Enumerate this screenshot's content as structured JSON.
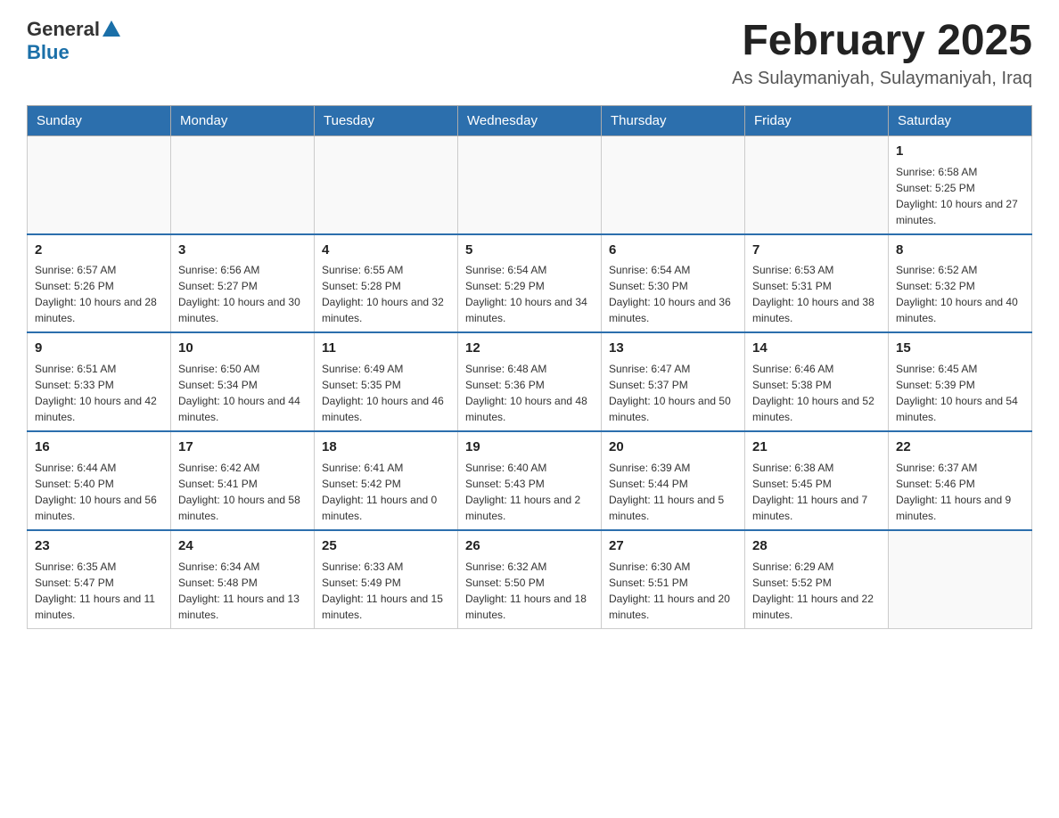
{
  "header": {
    "logo_general": "General",
    "logo_blue": "Blue",
    "month_title": "February 2025",
    "location": "As Sulaymaniyah, Sulaymaniyah, Iraq"
  },
  "weekdays": [
    "Sunday",
    "Monday",
    "Tuesday",
    "Wednesday",
    "Thursday",
    "Friday",
    "Saturday"
  ],
  "weeks": [
    [
      {
        "day": "",
        "info": ""
      },
      {
        "day": "",
        "info": ""
      },
      {
        "day": "",
        "info": ""
      },
      {
        "day": "",
        "info": ""
      },
      {
        "day": "",
        "info": ""
      },
      {
        "day": "",
        "info": ""
      },
      {
        "day": "1",
        "info": "Sunrise: 6:58 AM\nSunset: 5:25 PM\nDaylight: 10 hours and 27 minutes."
      }
    ],
    [
      {
        "day": "2",
        "info": "Sunrise: 6:57 AM\nSunset: 5:26 PM\nDaylight: 10 hours and 28 minutes."
      },
      {
        "day": "3",
        "info": "Sunrise: 6:56 AM\nSunset: 5:27 PM\nDaylight: 10 hours and 30 minutes."
      },
      {
        "day": "4",
        "info": "Sunrise: 6:55 AM\nSunset: 5:28 PM\nDaylight: 10 hours and 32 minutes."
      },
      {
        "day": "5",
        "info": "Sunrise: 6:54 AM\nSunset: 5:29 PM\nDaylight: 10 hours and 34 minutes."
      },
      {
        "day": "6",
        "info": "Sunrise: 6:54 AM\nSunset: 5:30 PM\nDaylight: 10 hours and 36 minutes."
      },
      {
        "day": "7",
        "info": "Sunrise: 6:53 AM\nSunset: 5:31 PM\nDaylight: 10 hours and 38 minutes."
      },
      {
        "day": "8",
        "info": "Sunrise: 6:52 AM\nSunset: 5:32 PM\nDaylight: 10 hours and 40 minutes."
      }
    ],
    [
      {
        "day": "9",
        "info": "Sunrise: 6:51 AM\nSunset: 5:33 PM\nDaylight: 10 hours and 42 minutes."
      },
      {
        "day": "10",
        "info": "Sunrise: 6:50 AM\nSunset: 5:34 PM\nDaylight: 10 hours and 44 minutes."
      },
      {
        "day": "11",
        "info": "Sunrise: 6:49 AM\nSunset: 5:35 PM\nDaylight: 10 hours and 46 minutes."
      },
      {
        "day": "12",
        "info": "Sunrise: 6:48 AM\nSunset: 5:36 PM\nDaylight: 10 hours and 48 minutes."
      },
      {
        "day": "13",
        "info": "Sunrise: 6:47 AM\nSunset: 5:37 PM\nDaylight: 10 hours and 50 minutes."
      },
      {
        "day": "14",
        "info": "Sunrise: 6:46 AM\nSunset: 5:38 PM\nDaylight: 10 hours and 52 minutes."
      },
      {
        "day": "15",
        "info": "Sunrise: 6:45 AM\nSunset: 5:39 PM\nDaylight: 10 hours and 54 minutes."
      }
    ],
    [
      {
        "day": "16",
        "info": "Sunrise: 6:44 AM\nSunset: 5:40 PM\nDaylight: 10 hours and 56 minutes."
      },
      {
        "day": "17",
        "info": "Sunrise: 6:42 AM\nSunset: 5:41 PM\nDaylight: 10 hours and 58 minutes."
      },
      {
        "day": "18",
        "info": "Sunrise: 6:41 AM\nSunset: 5:42 PM\nDaylight: 11 hours and 0 minutes."
      },
      {
        "day": "19",
        "info": "Sunrise: 6:40 AM\nSunset: 5:43 PM\nDaylight: 11 hours and 2 minutes."
      },
      {
        "day": "20",
        "info": "Sunrise: 6:39 AM\nSunset: 5:44 PM\nDaylight: 11 hours and 5 minutes."
      },
      {
        "day": "21",
        "info": "Sunrise: 6:38 AM\nSunset: 5:45 PM\nDaylight: 11 hours and 7 minutes."
      },
      {
        "day": "22",
        "info": "Sunrise: 6:37 AM\nSunset: 5:46 PM\nDaylight: 11 hours and 9 minutes."
      }
    ],
    [
      {
        "day": "23",
        "info": "Sunrise: 6:35 AM\nSunset: 5:47 PM\nDaylight: 11 hours and 11 minutes."
      },
      {
        "day": "24",
        "info": "Sunrise: 6:34 AM\nSunset: 5:48 PM\nDaylight: 11 hours and 13 minutes."
      },
      {
        "day": "25",
        "info": "Sunrise: 6:33 AM\nSunset: 5:49 PM\nDaylight: 11 hours and 15 minutes."
      },
      {
        "day": "26",
        "info": "Sunrise: 6:32 AM\nSunset: 5:50 PM\nDaylight: 11 hours and 18 minutes."
      },
      {
        "day": "27",
        "info": "Sunrise: 6:30 AM\nSunset: 5:51 PM\nDaylight: 11 hours and 20 minutes."
      },
      {
        "day": "28",
        "info": "Sunrise: 6:29 AM\nSunset: 5:52 PM\nDaylight: 11 hours and 22 minutes."
      },
      {
        "day": "",
        "info": ""
      }
    ]
  ]
}
